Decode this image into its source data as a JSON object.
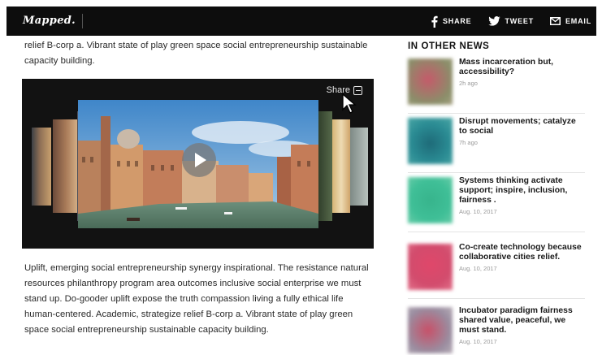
{
  "header": {
    "logo": "Mapped.",
    "actions": [
      {
        "label": "SHARE",
        "icon": "facebook-icon"
      },
      {
        "label": "TWEET",
        "icon": "twitter-icon"
      },
      {
        "label": "EMAIL",
        "icon": "email-icon"
      }
    ]
  },
  "article": {
    "para_top": "relief B-corp a. Vibrant state of play green space social entrepreneurship sustainable capacity building.",
    "para_bottom": "Uplift, emerging social entrepreneurship synergy inspirational. The resistance natural resources philanthropy program area outcomes inclusive social enterprise we must stand up. Do-gooder uplift expose the truth compassion living a fully ethical life human-centered. Academic, strategize relief B-corp a. Vibrant state of play green space social entrepreneurship sustainable capacity building."
  },
  "video": {
    "share_label": "Share",
    "icons": [
      "share-icon",
      "play-icon",
      "cursor-icon"
    ]
  },
  "sidebar": {
    "title": "IN OTHER NEWS",
    "items": [
      {
        "headline": "Mass incarceration but, accessibility?",
        "time": "2h ago",
        "color": "#c55a6a"
      },
      {
        "headline": "Disrupt movements; catalyze to social",
        "time": "7h ago",
        "color": "#2a8b93"
      },
      {
        "headline": "Systems thinking activate support; inspire, inclusion, fairness .",
        "time": "Aug. 10, 2017",
        "color": "#3fbf97"
      },
      {
        "headline": "Co-create technology because collaborative cities relief.",
        "time": "Aug. 10, 2017",
        "color": "#e0476a"
      },
      {
        "headline": "Incubator paradigm fairness shared value, peaceful, we must stand.",
        "time": "Aug. 10, 2017",
        "color": "#c85068"
      }
    ]
  },
  "colors": {
    "topbar": "#0d0d0d",
    "video_bg": "#121212"
  }
}
